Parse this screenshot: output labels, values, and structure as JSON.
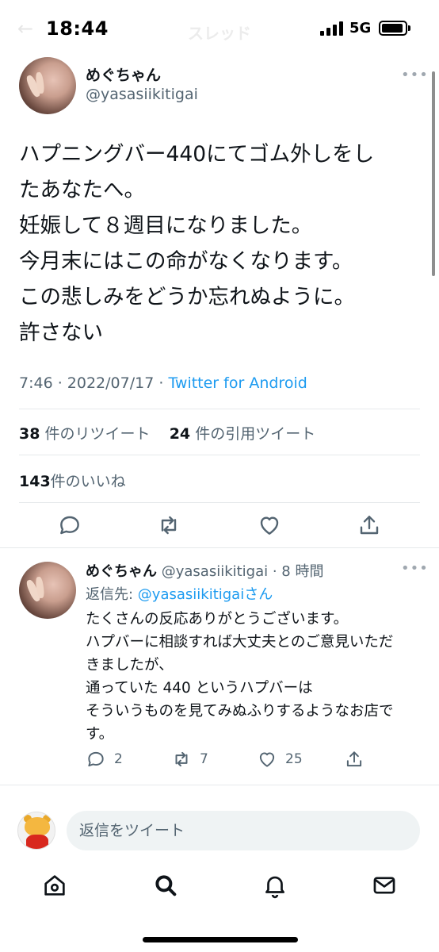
{
  "status_bar": {
    "time": "18:44",
    "network": "5G",
    "back_glyph": "←",
    "header_title": "スレッド"
  },
  "main_tweet": {
    "name": "めぐちゃん",
    "handle": "@yasasiikitigai",
    "text_lines": [
      "ハプニングバー440にてゴム外しをし",
      "たあなたへ。",
      "妊娠して８週目になりました。",
      "今月末にはこの命がなくなります。",
      "この悲しみをどうか忘れぬように。",
      "許さない"
    ],
    "time": "7:46",
    "date": "2022/07/17",
    "separator": " · ",
    "source": "Twitter for Android",
    "retweets_count": "38",
    "retweets_label": "件のリツイート",
    "quotes_count": "24",
    "quotes_label": "件の引用ツイート",
    "likes_count": "143",
    "likes_label": "件のいいね",
    "more_glyph": "•••"
  },
  "reply_tweet": {
    "name": "めぐちゃん",
    "handle_time": " @yasasiikitigai · 8 時間",
    "reply_prefix": "返信先: ",
    "reply_mention": "@yasasiikitigai",
    "reply_suffix": "さん",
    "text_lines": [
      "たくさんの反応ありがとうございます。",
      "ハプバーに相談すれば大丈夫とのご意見いただ",
      "きましたが、",
      "通っていた 440 というハプバーは",
      "そういうものを見てみぬふりするようなお店で",
      "す。"
    ],
    "reply_count": "2",
    "retweet_count": "7",
    "like_count": "25",
    "more_glyph": "•••"
  },
  "composer": {
    "placeholder": "返信をツイート"
  },
  "icons": {
    "reply": "reply-icon",
    "retweet": "retweet-icon",
    "like": "heart-icon",
    "share": "share-icon",
    "home": "home-icon",
    "search": "search-icon",
    "notifications": "bell-icon",
    "messages": "mail-icon"
  },
  "colors": {
    "link": "#1d9bf0",
    "secondary_text": "#536471",
    "primary_text": "#0f1419"
  }
}
